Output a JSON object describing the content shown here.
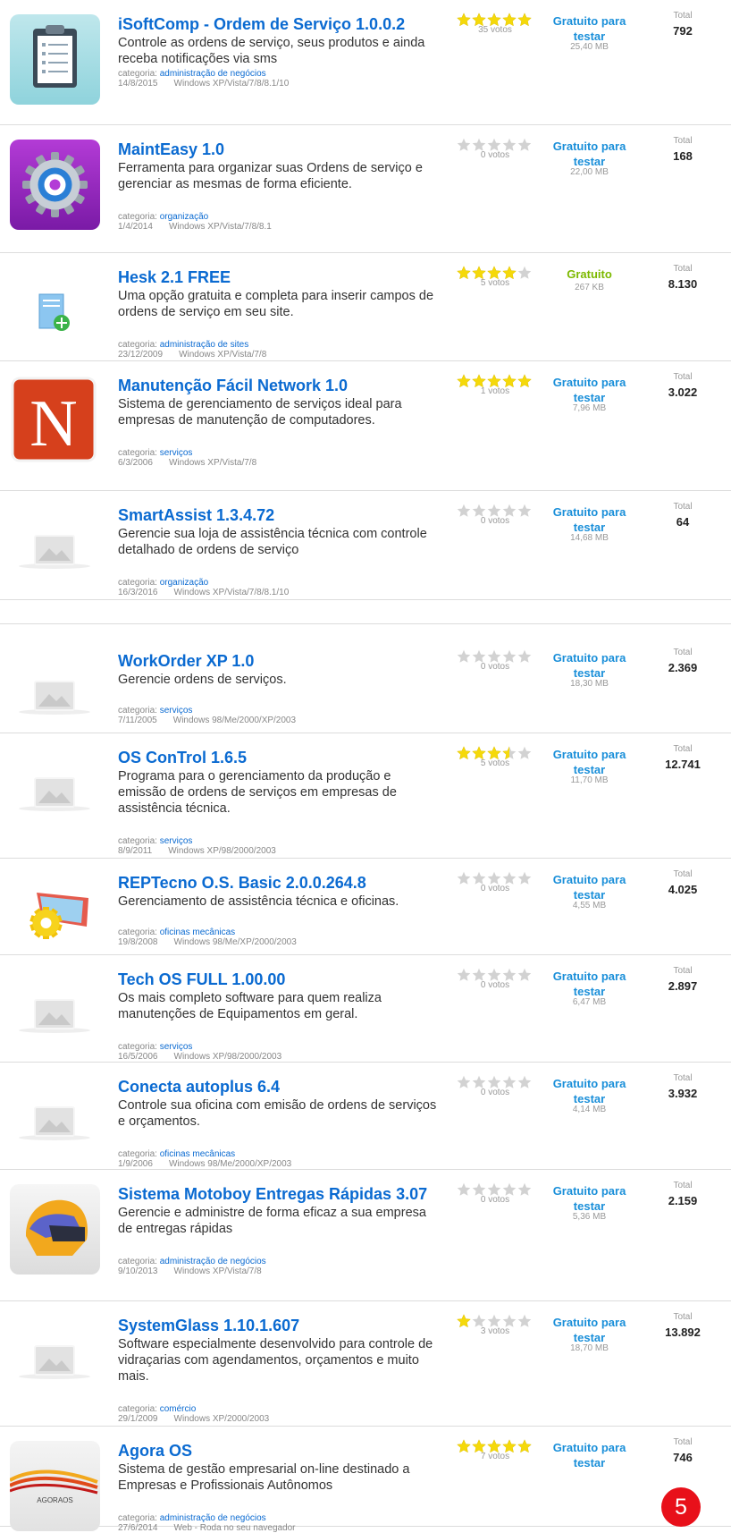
{
  "labels": {
    "category_prefix": "categoria:",
    "total": "Total"
  },
  "items": [
    {
      "title": "iSoftComp - Ordem de Serviço 1.0.0.2",
      "desc": "Controle as ordens de serviço, seus produtos e ainda receba notificações via sms",
      "category": "administração de negócios",
      "date": "14/8/2015",
      "os": "Windows XP/Vista/7/8/8.1/10",
      "rating": 5,
      "votes": "35 votos",
      "price": "Gratuito para testar",
      "size": "25,40 MB",
      "total": "792",
      "icon": "clipboard-icon"
    },
    {
      "title": "MaintEasy 1.0",
      "desc": "Ferramenta para organizar suas Ordens de serviço e gerenciar as mesmas de forma eficiente.",
      "category": "organização",
      "date": "1/4/2014",
      "os": "Windows XP/Vista/7/8/8.1",
      "rating": 0,
      "votes": "0 votos",
      "price": "Gratuito para testar",
      "size": "22,00 MB",
      "total": "168",
      "icon": "gear-icon"
    },
    {
      "title": "Hesk 2.1 FREE",
      "desc": "Uma opção gratuita e completa para inserir campos de ordens de serviço em seu site.",
      "category": "administração de sites",
      "date": "23/12/2009",
      "os": "Windows XP/Vista/7/8",
      "rating": 4,
      "votes": "5 votos",
      "price": "Gratuito",
      "size": "267 KB",
      "total": "8.130",
      "icon": "document-add-icon"
    },
    {
      "title": "Manutenção Fácil Network 1.0",
      "desc": "Sistema de gerenciamento de serviços ideal para empresas de manutenção de computadores.",
      "category": "serviços",
      "date": "6/3/2006",
      "os": "Windows XP/Vista/7/8",
      "rating": 5,
      "votes": "1 votos",
      "price": "Gratuito para testar",
      "size": "7,96 MB",
      "total": "3.022",
      "icon": "letter-n-icon"
    },
    {
      "title": "SmartAssist 1.3.4.72",
      "desc": "Gerencie sua loja de assistência técnica com controle detalhado de ordens de serviço",
      "category": "organização",
      "date": "16/3/2016",
      "os": "Windows XP/Vista/7/8/8.1/10",
      "rating": 0,
      "votes": "0 votos",
      "price": "Gratuito para testar",
      "size": "14,68 MB",
      "total": "64",
      "icon": "placeholder-image-icon"
    },
    {
      "title": "WorkOrder XP 1.0",
      "desc": "Gerencie ordens de serviços.",
      "category": "serviços",
      "date": "7/11/2005",
      "os": "Windows 98/Me/2000/XP/2003",
      "rating": 0,
      "votes": "0 votos",
      "price": "Gratuito para testar",
      "size": "18,30 MB",
      "total": "2.369",
      "icon": "placeholder-image-icon"
    },
    {
      "title": "OS ConTrol 1.6.5",
      "desc": "Programa para o gerenciamento da produção e emissão de ordens de serviços em empresas de assistência técnica.",
      "category": "serviços",
      "date": "8/9/2011",
      "os": "Windows XP/98/2000/2003",
      "rating": 3.5,
      "votes": "5 votos",
      "price": "Gratuito para testar",
      "size": "11,70 MB",
      "total": "12.741",
      "icon": "placeholder-image-icon"
    },
    {
      "title": "REPTecno O.S. Basic 2.0.0.264.8",
      "desc": "Gerenciamento de assistência técnica e oficinas.",
      "category": "oficinas mecânicas",
      "date": "19/8/2008",
      "os": "Windows 98/Me/XP/2000/2003",
      "rating": 0,
      "votes": "0 votos",
      "price": "Gratuito para testar",
      "size": "4,55 MB",
      "total": "4.025",
      "icon": "gear-book-icon"
    },
    {
      "title": "Tech OS FULL 1.00.00",
      "desc": "Os mais completo software para quem realiza manutenções de Equipamentos em geral.",
      "category": "serviços",
      "date": "16/5/2006",
      "os": "Windows XP/98/2000/2003",
      "rating": 0,
      "votes": "0 votos",
      "price": "Gratuito para testar",
      "size": "6,47 MB",
      "total": "2.897",
      "icon": "placeholder-image-icon"
    },
    {
      "title": "Conecta autoplus 6.4",
      "desc": "Controle sua oficina com emisão de ordens de serviços e orçamentos.",
      "category": "oficinas mecânicas",
      "date": "1/9/2006",
      "os": "Windows 98/Me/2000/XP/2003",
      "rating": 0,
      "votes": "0 votos",
      "price": "Gratuito para testar",
      "size": "4,14 MB",
      "total": "3.932",
      "icon": "placeholder-image-icon"
    },
    {
      "title": "Sistema Motoboy Entregas Rápidas 3.07",
      "desc": "Gerencie e administre de forma eficaz a sua empresa de entregas rápidas",
      "category": "administração de negócios",
      "date": "9/10/2013",
      "os": "Windows XP/Vista/7/8",
      "rating": 0,
      "votes": "0 votos",
      "price": "Gratuito para testar",
      "size": "5,36 MB",
      "total": "2.159",
      "icon": "helmet-icon"
    },
    {
      "title": "SystemGlass 1.10.1.607",
      "desc": "Software especialmente desenvolvido para controle de vidraçarias com agendamentos, orçamentos e muito mais.",
      "category": "comércio",
      "date": "29/1/2009",
      "os": "Windows XP/2000/2003",
      "rating": 1,
      "votes": "3 votos",
      "price": "Gratuito para testar",
      "size": "18,70 MB",
      "total": "13.892",
      "icon": "placeholder-image-icon"
    },
    {
      "title": "Agora OS",
      "desc": "Sistema de gestão empresarial on-line destinado a Empresas e Profissionais Autônomos",
      "category": "administração de negócios",
      "date": "27/6/2014",
      "os": "Web - Roda no seu navegador",
      "rating": 5,
      "votes": "7 votos",
      "price": "Gratuito para testar",
      "size": "",
      "total": "746",
      "icon": "agoraos-logo",
      "logo_text": "AGORAOS"
    }
  ],
  "badge": "5",
  "colors": {
    "link": "#0a6ad1",
    "price": "#1a8fd9",
    "free": "#7cb900",
    "star": "#f5d90a",
    "badge": "#e8101a"
  }
}
